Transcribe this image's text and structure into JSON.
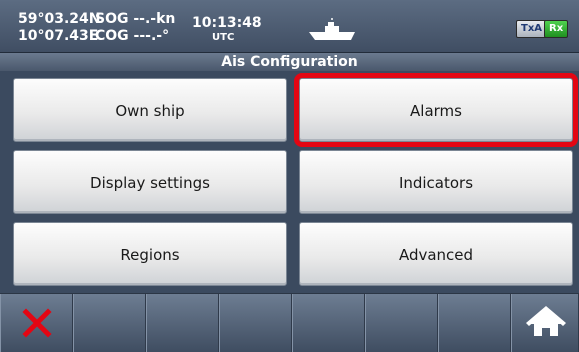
{
  "status": {
    "latitude": "59°03.24N",
    "longitude": "10°07.43E",
    "sog": "SOG --.-kn",
    "cog": "COG ---.-°",
    "time": "10:13:48",
    "timezone": "UTC",
    "ship_icon": "ship-icon",
    "txa_label": "TxA",
    "rx_label": "Rx",
    "rx_color": "#2db52d"
  },
  "title": "Ais Configuration",
  "menu": {
    "own_ship": "Own ship",
    "alarms": "Alarms",
    "display_settings": "Display settings",
    "indicators": "Indicators",
    "regions": "Regions",
    "advanced": "Advanced"
  },
  "selected_color": "#e30613",
  "bottom": {
    "close_icon": "close-icon",
    "home_icon": "home-icon"
  }
}
